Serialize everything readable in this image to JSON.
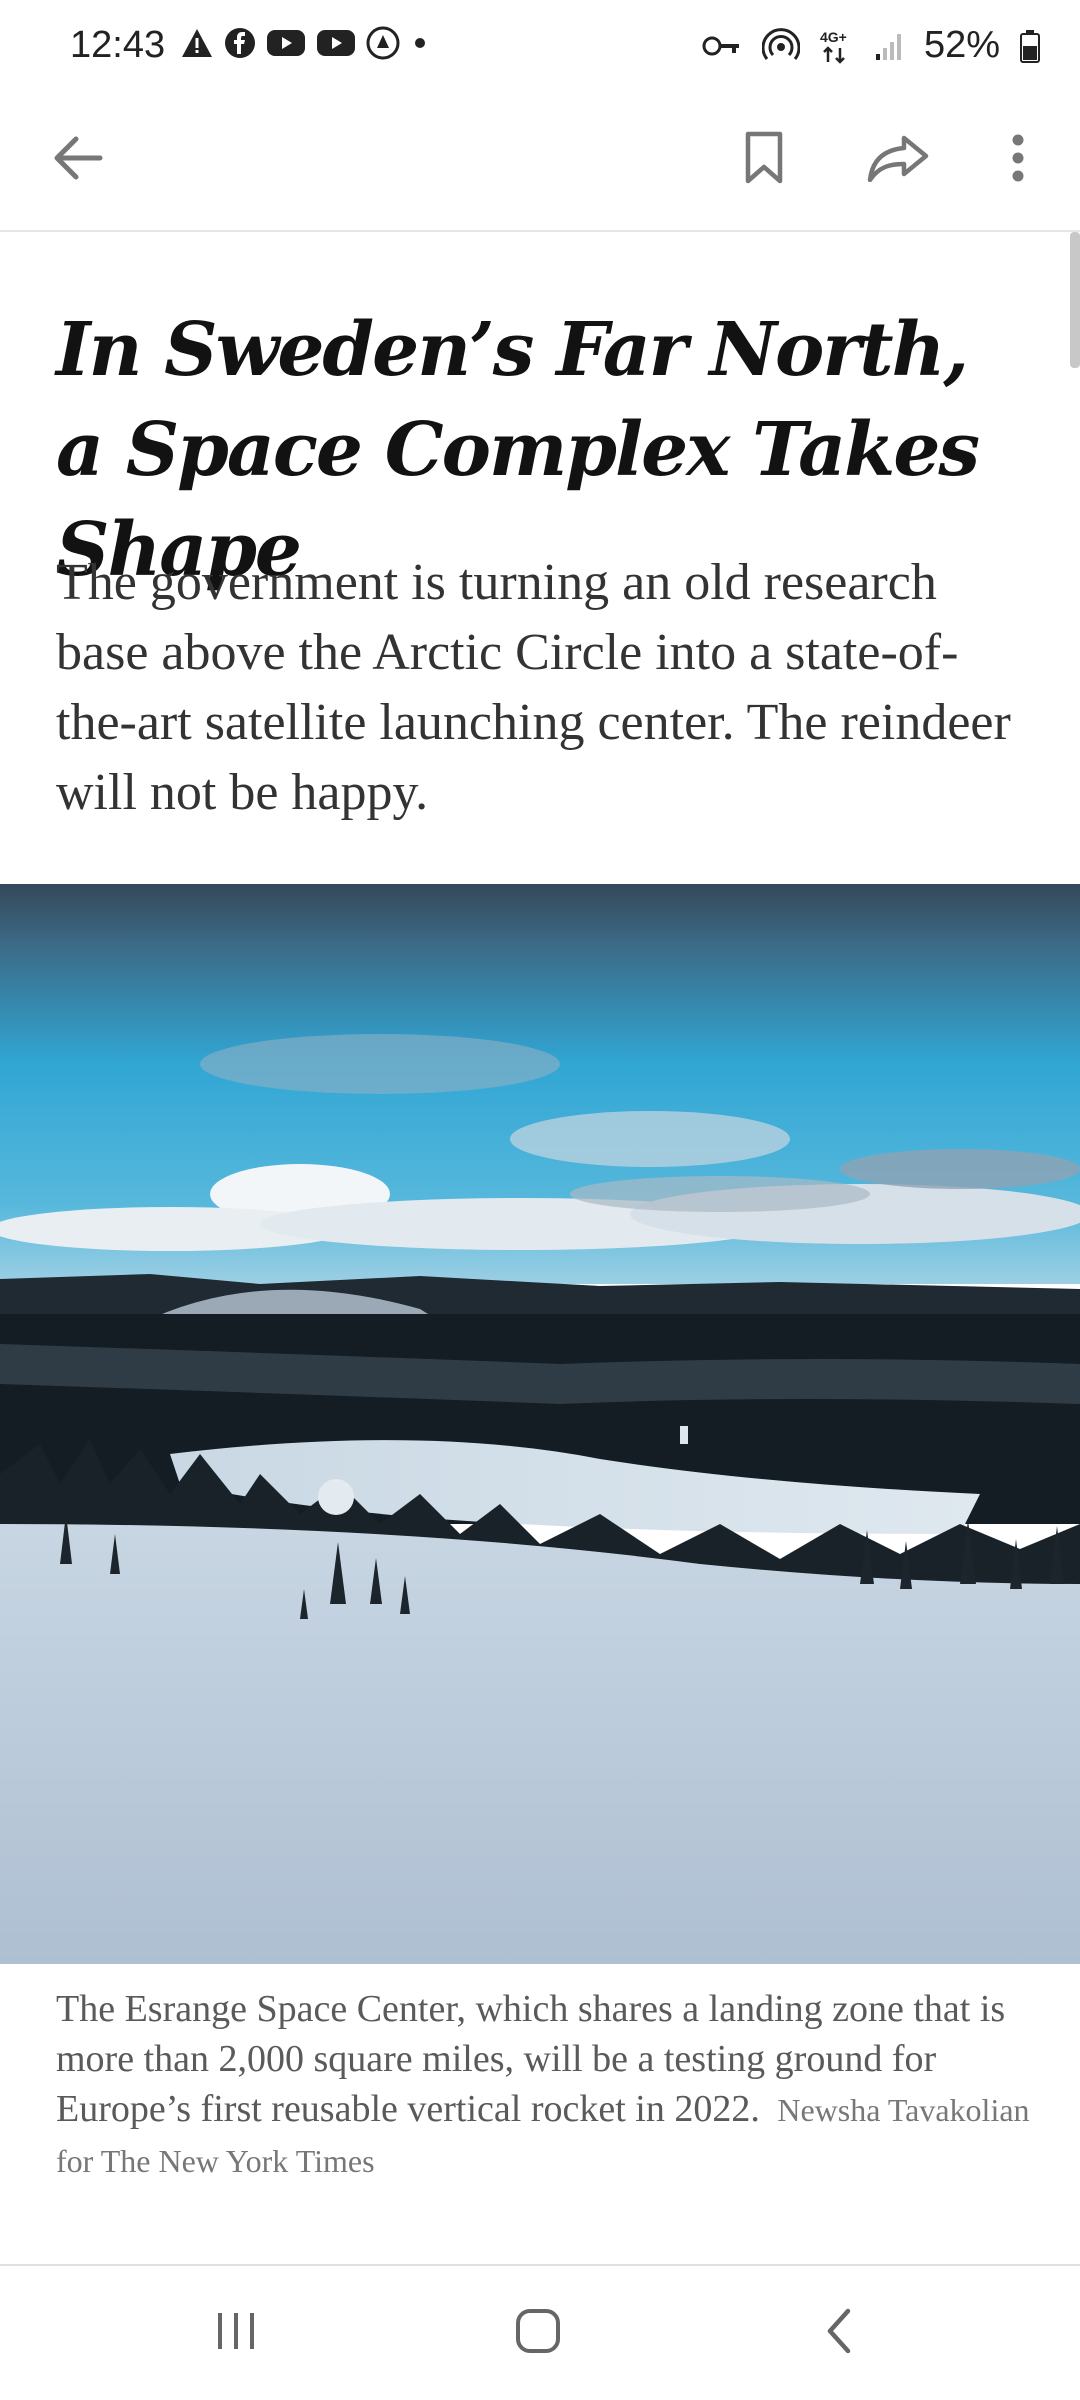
{
  "status_bar": {
    "time": "12:43",
    "battery": "52%",
    "left_icons": [
      "warning-icon",
      "facebook-icon",
      "youtube-icon",
      "youtube-icon",
      "app-icon",
      "dot-icon"
    ],
    "right_icons": [
      "vpn-key-icon",
      "hotspot-icon",
      "4g-icon",
      "signal-icon",
      "battery-icon"
    ],
    "network_label": "4G+"
  },
  "toolbar": {
    "back_icon": "arrow-left-icon",
    "bookmark_icon": "bookmark-icon",
    "share_icon": "share-icon",
    "more_icon": "more-vert-icon"
  },
  "article": {
    "headline": "In Sweden’s Far North, a Space Complex Takes Shape",
    "summary": "The government is turning an old research base above the Arctic Circle into a state-of-the-art satellite launching center. The reindeer will not be happy.",
    "caption": "The Esrange Space Center, which shares a landing zone that is more than 2,000 square miles, will be a testing ground for Europe’s first reusable vertical rocket in 2022.",
    "credit": "Newsha Tavakolian for The New York Times"
  },
  "nav_bar": {
    "recents_icon": "recents-icon",
    "home_icon": "home-icon",
    "back_icon": "nav-back-icon"
  }
}
